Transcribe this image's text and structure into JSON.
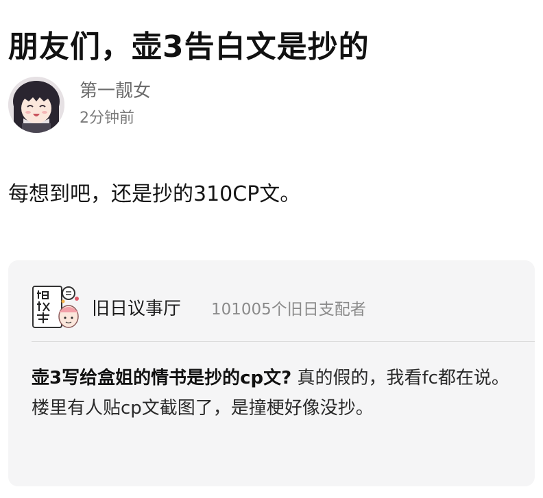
{
  "post": {
    "title": "朋友们，壶3告白文是抄的",
    "author": {
      "name": "第一靓女",
      "time": "2分钟前",
      "avatar_icon": "anime-girl-avatar-icon"
    },
    "body": "每想到吧，还是抄的310CP文。"
  },
  "quote_card": {
    "group": {
      "name": "旧日议事厅",
      "members": "101005个旧日支配者",
      "logo_icon": "group-logo-icon"
    },
    "post_title": "壶3写给盒姐的情书是抄的cp文?",
    "post_excerpt": " 真的假的，我看fc都在说。 楼里有人贴cp文截图了，是撞梗好像没抄。"
  },
  "colors": {
    "card_background": "#f5f5f6",
    "secondary_text": "#7a7a7a",
    "divider": "#dcdcdc"
  }
}
